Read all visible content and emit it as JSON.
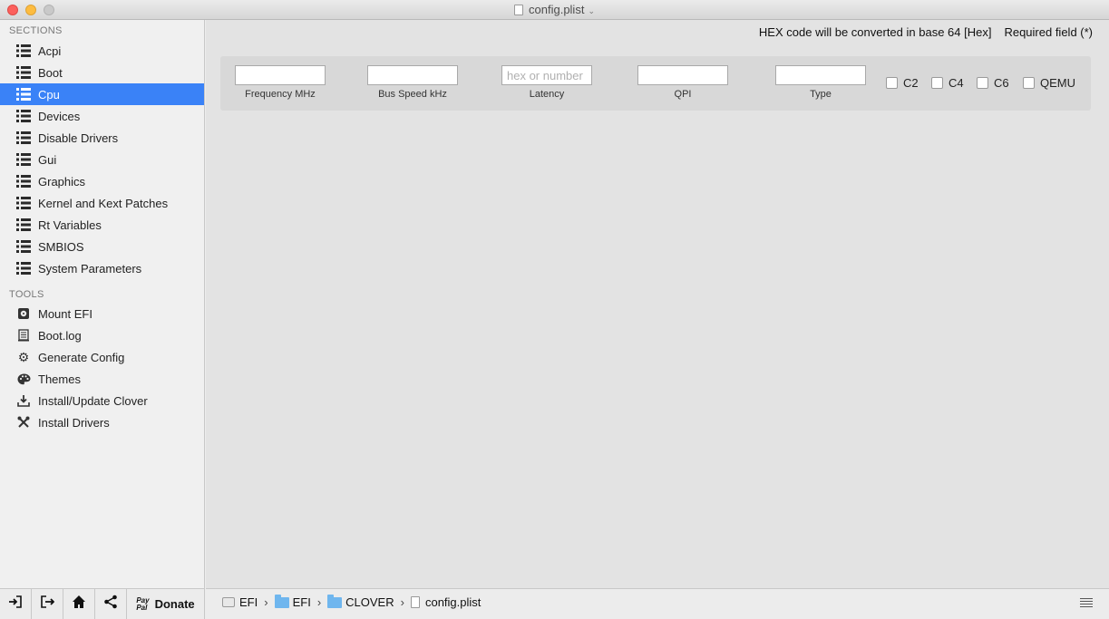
{
  "window": {
    "title": "config.plist"
  },
  "sidebar": {
    "sections_header": "SECTIONS",
    "sections": [
      {
        "label": "Acpi"
      },
      {
        "label": "Boot"
      },
      {
        "label": "Cpu",
        "selected": true
      },
      {
        "label": "Devices"
      },
      {
        "label": "Disable Drivers"
      },
      {
        "label": "Gui"
      },
      {
        "label": "Graphics"
      },
      {
        "label": "Kernel and Kext Patches"
      },
      {
        "label": "Rt Variables"
      },
      {
        "label": "SMBIOS"
      },
      {
        "label": "System Parameters"
      }
    ],
    "tools_header": "TOOLS",
    "tools": [
      {
        "label": "Mount EFI",
        "icon": "disk-icon"
      },
      {
        "label": "Boot.log",
        "icon": "log-icon"
      },
      {
        "label": "Generate Config",
        "icon": "gears-icon"
      },
      {
        "label": "Themes",
        "icon": "palette-icon"
      },
      {
        "label": "Install/Update Clover",
        "icon": "download-icon"
      },
      {
        "label": "Install Drivers",
        "icon": "tools-icon"
      }
    ]
  },
  "bottom_toolbar": {
    "paypal_line1": "Pay",
    "paypal_line2": "Pal",
    "donate_label": "Donate"
  },
  "main": {
    "hex_note": "HEX code will be converted in base 64 [Hex]",
    "required_note": "Required field (*)",
    "fields": [
      {
        "label": "Frequency MHz",
        "value": "",
        "placeholder": ""
      },
      {
        "label": "Bus Speed kHz",
        "value": "",
        "placeholder": ""
      },
      {
        "label": "Latency",
        "value": "",
        "placeholder": "hex or number"
      },
      {
        "label": "QPI",
        "value": "",
        "placeholder": ""
      },
      {
        "label": "Type",
        "value": "",
        "placeholder": ""
      }
    ],
    "checkboxes": [
      {
        "label": "C2",
        "checked": false
      },
      {
        "label": "C4",
        "checked": false
      },
      {
        "label": "C6",
        "checked": false
      },
      {
        "label": "QEMU",
        "checked": false
      }
    ]
  },
  "pathbar": {
    "crumbs": [
      "EFI",
      "EFI",
      "CLOVER",
      "config.plist"
    ]
  },
  "colors": {
    "selection": "#3a82f7"
  }
}
